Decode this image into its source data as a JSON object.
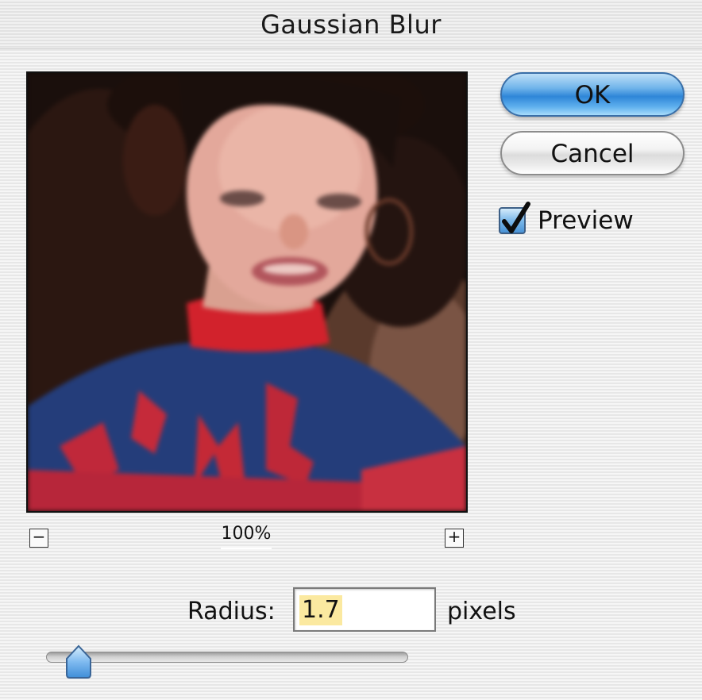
{
  "dialog": {
    "title": "Gaussian Blur"
  },
  "buttons": {
    "ok_label": "OK",
    "cancel_label": "Cancel"
  },
  "preview": {
    "checkbox_label": "Preview",
    "checked": true
  },
  "zoom": {
    "level": "100%",
    "zoom_out_label": "−",
    "zoom_in_label": "+"
  },
  "radius": {
    "label": "Radius:",
    "value": "1.7",
    "unit": "pixels",
    "slider_fraction": 0.09
  },
  "colors": {
    "ok_button_blue": "#2e86d8",
    "selection_highlight": "#fbe9a0",
    "checkbox_blue": "#4a93d6"
  },
  "icons": {
    "checkmark": "checkmark-icon",
    "zoom_out": "minus-icon",
    "zoom_in": "plus-icon"
  }
}
